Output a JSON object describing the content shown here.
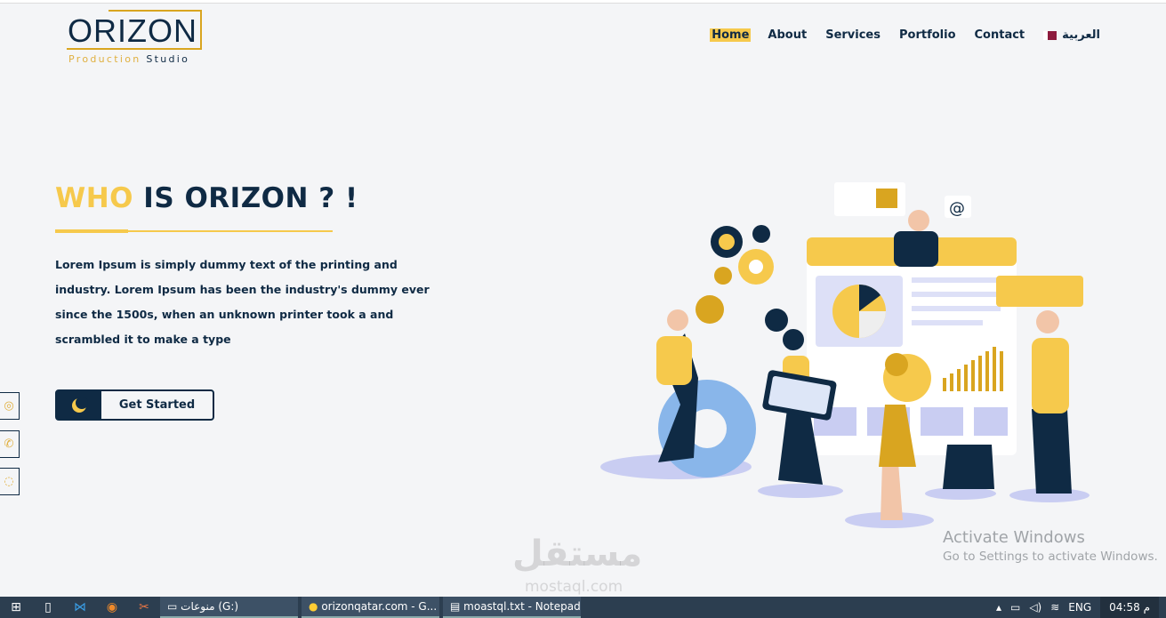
{
  "logo": {
    "word": "ORIZON",
    "sub1": "Production",
    "sub2": "Studio"
  },
  "nav": {
    "items": [
      "Home",
      "About",
      "Services",
      "Portfolio",
      "Contact"
    ],
    "lang": "العربية",
    "active": "Home"
  },
  "hero": {
    "title_a": "WHO",
    "title_b": "IS ORIZON ? !",
    "body": "Lorem Ipsum is simply dummy text of the printing and industry. Lorem Ipsum has been the industry's dummy ever since the 1500s, when an unknown printer took a and scrambled it to make a type",
    "cta": "Get Started"
  },
  "social": [
    "instagram-icon",
    "phone-icon",
    "whatsapp-icon"
  ],
  "activation": {
    "title": "Activate Windows",
    "subtitle": "Go to Settings to activate Windows."
  },
  "watermark": {
    "ar": "مستقل",
    "en": "mostaql.com"
  },
  "taskbar": {
    "windows": [
      "منوعات (G:)",
      "orizonqatar.com - G...",
      "moastql.txt - Notepad"
    ],
    "lang": "ENG",
    "time": "04:58 م"
  },
  "colors": {
    "navy": "#0f2a44",
    "yellow": "#f6c94c",
    "gold": "#d9a520"
  }
}
